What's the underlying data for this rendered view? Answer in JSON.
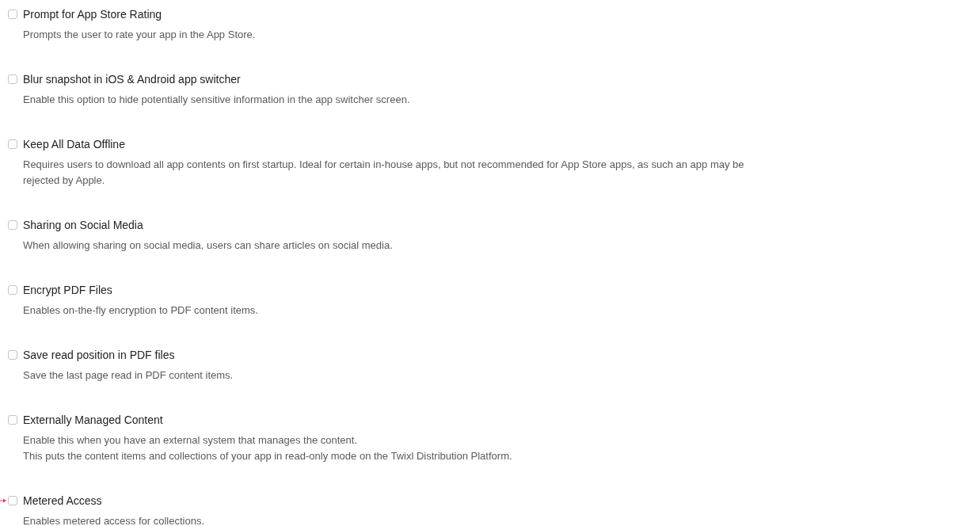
{
  "options": [
    {
      "label": "Prompt for App Store Rating",
      "description": "Prompts the user to rate your app in the App Store.",
      "checked": false,
      "marked": false
    },
    {
      "label": "Blur snapshot in iOS & Android app switcher",
      "description": "Enable this option to hide potentially sensitive information in the app switcher screen.",
      "checked": false,
      "marked": false
    },
    {
      "label": "Keep All Data Offline",
      "description": "Requires users to download all app contents on first startup. Ideal for certain in-house apps, but not recommended for App Store apps, as such an app may be rejected by Apple.",
      "checked": false,
      "marked": false
    },
    {
      "label": "Sharing on Social Media",
      "description": "When allowing sharing on social media, users can share articles on social media.",
      "checked": false,
      "marked": false
    },
    {
      "label": "Encrypt PDF Files",
      "description": "Enables on-the-fly encryption to PDF content items.",
      "checked": false,
      "marked": false
    },
    {
      "label": "Save read position in PDF files",
      "description": "Save the last page read in PDF content items.",
      "checked": false,
      "marked": false
    },
    {
      "label": "Externally Managed Content",
      "description": "Enable this when you have an external system that manages the content.\nThis puts the content items and collections of your app in read-only mode on the Twixl Distribution Platform.",
      "checked": false,
      "marked": false
    },
    {
      "label": "Metered Access",
      "description": "Enables metered access for collections.",
      "checked": false,
      "marked": true
    }
  ]
}
